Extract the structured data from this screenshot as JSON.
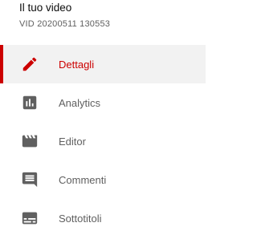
{
  "video": {
    "title": "Il tuo video",
    "id_label": "VID 20200511 130553"
  },
  "nav": {
    "active_color": "#cc0000",
    "items": [
      {
        "label": "Dettagli",
        "icon": "pencil-icon",
        "active": true
      },
      {
        "label": "Analytics",
        "icon": "analytics-icon",
        "active": false
      },
      {
        "label": "Editor",
        "icon": "clapperboard-icon",
        "active": false
      },
      {
        "label": "Commenti",
        "icon": "comment-icon",
        "active": false
      },
      {
        "label": "Sottotitoli",
        "icon": "subtitles-icon",
        "active": false
      }
    ]
  }
}
